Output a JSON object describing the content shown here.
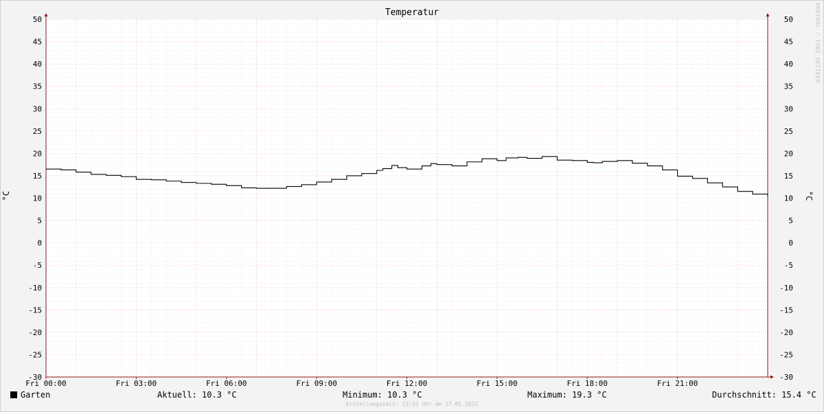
{
  "chart_data": {
    "type": "line",
    "title": "Temperatur",
    "ylabel": "°C",
    "ylabel_right": "°C",
    "ylim": [
      -30,
      50
    ],
    "yticks": [
      50,
      45,
      40,
      35,
      30,
      25,
      20,
      15,
      10,
      5,
      0,
      -5,
      -10,
      -15,
      -20,
      -25,
      -30
    ],
    "xlim": [
      0,
      24
    ],
    "xticks": [
      {
        "value": 0,
        "label": "Fri 00:00"
      },
      {
        "value": 3,
        "label": "Fri 03:00"
      },
      {
        "value": 6,
        "label": "Fri 06:00"
      },
      {
        "value": 9,
        "label": "Fri 09:00"
      },
      {
        "value": 12,
        "label": "Fri 12:00"
      },
      {
        "value": 15,
        "label": "Fri 15:00"
      },
      {
        "value": 18,
        "label": "Fri 18:00"
      },
      {
        "value": 21,
        "label": "Fri 21:00"
      }
    ],
    "grid": true,
    "series": [
      {
        "name": "Garten",
        "color": "#000000",
        "x": [
          0,
          0.5,
          1,
          1.5,
          2,
          2.5,
          3,
          3.5,
          4,
          4.5,
          5,
          5.5,
          6,
          6.5,
          7,
          7.5,
          8,
          8.5,
          9,
          9.5,
          10,
          10.5,
          11,
          11.2,
          11.5,
          11.7,
          12,
          12.5,
          12.8,
          13,
          13.5,
          14,
          14.5,
          15,
          15.3,
          15.7,
          16,
          16.5,
          17,
          17.5,
          18,
          18.2,
          18.5,
          19,
          19.5,
          20,
          20.5,
          21,
          21.5,
          22,
          22.5,
          23,
          23.5,
          24
        ],
        "y": [
          16.5,
          16.3,
          15.8,
          15.3,
          15.1,
          14.8,
          14.2,
          14.1,
          13.8,
          13.5,
          13.3,
          13.1,
          12.8,
          12.3,
          12.2,
          12.2,
          12.6,
          13.0,
          13.6,
          14.2,
          15.0,
          15.5,
          16.2,
          16.6,
          17.3,
          16.8,
          16.5,
          17.2,
          17.7,
          17.5,
          17.2,
          18.1,
          18.8,
          18.4,
          19.0,
          19.1,
          18.9,
          19.3,
          18.5,
          18.4,
          18.0,
          17.9,
          18.2,
          18.4,
          17.8,
          17.2,
          16.3,
          14.9,
          14.4,
          13.4,
          12.5,
          11.5,
          10.9,
          10.3
        ]
      }
    ],
    "legend": [
      {
        "name": "Garten",
        "current": "Aktuell: 10.3 °C",
        "minimum": "Minimum: 10.3 °C",
        "maximum": "Maximum: 19.3 °C",
        "average": "Durchschnitt: 15.4 °C"
      }
    ]
  },
  "watermark": "RRDTOOL / TOBI OETIKER",
  "footer": "Erstellungszeit: 23:55 Uhr am 27.05.2022",
  "colors": {
    "background": "#f3f3f3",
    "plot_background": "#ffffff",
    "minor_grid": "#dddddd",
    "major_grid": "#e6a4a4",
    "axis": "#8b1a1a",
    "line": "#000000"
  }
}
